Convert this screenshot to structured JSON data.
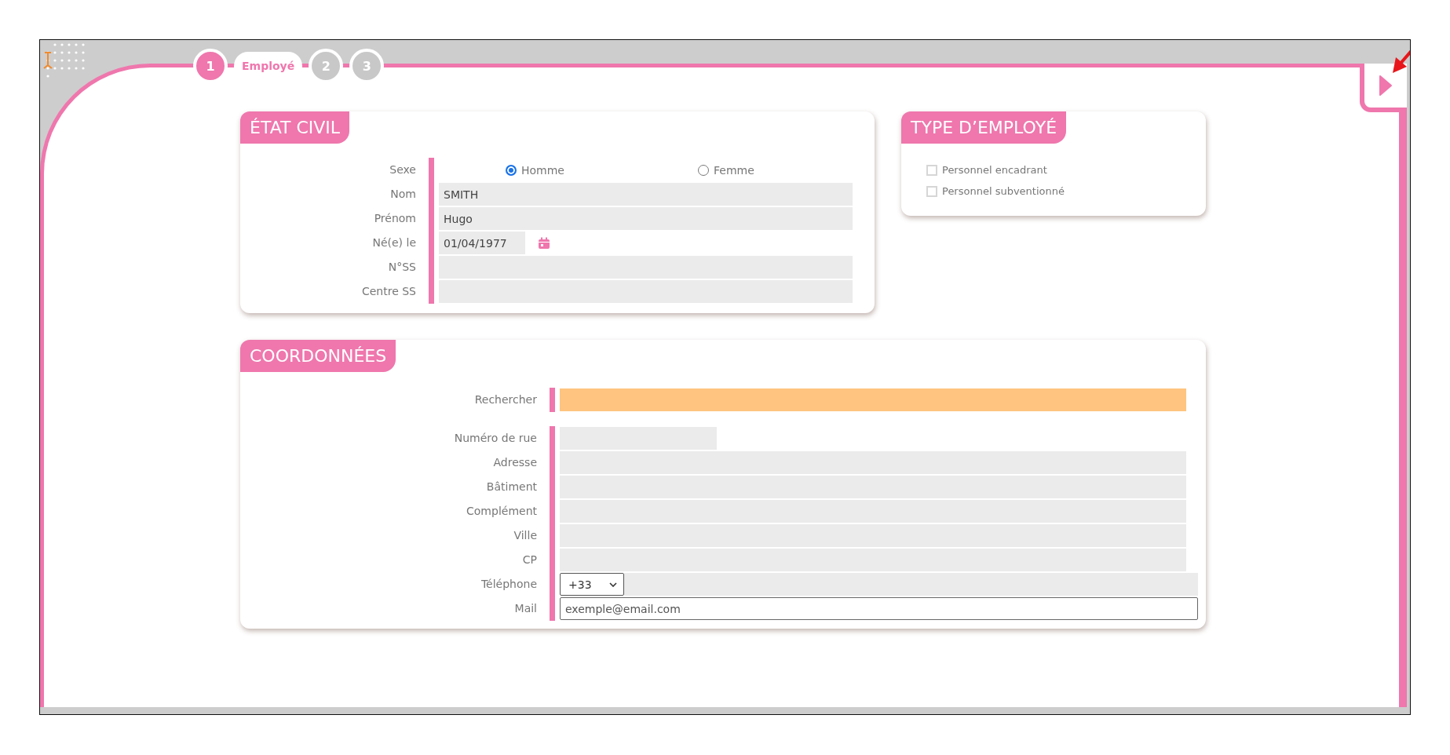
{
  "stepper": {
    "steps": [
      {
        "number": "1",
        "label": "Employé",
        "selected": true
      },
      {
        "number": "2",
        "selected": false
      },
      {
        "number": "3",
        "selected": false
      }
    ]
  },
  "etat_civil": {
    "title": "ÉTAT CIVIL",
    "fields": [
      {
        "kind": "radio",
        "label": "Sexe",
        "options": [
          {
            "label": "Homme",
            "selected": true
          },
          {
            "label": "Femme",
            "selected": false
          }
        ]
      },
      {
        "kind": "text",
        "label": "Nom",
        "value": "SMITH"
      },
      {
        "kind": "text",
        "label": "Prénom",
        "value": "Hugo"
      },
      {
        "kind": "date",
        "label": "Né(e) le",
        "value": "01/04/1977"
      },
      {
        "kind": "text",
        "label": "N°SS"
      },
      {
        "kind": "text",
        "label": "Centre SS"
      }
    ]
  },
  "type_employe": {
    "title": "TYPE D’EMPLOYÉ",
    "options": [
      {
        "label": "Personnel encadrant",
        "checked": false
      },
      {
        "label": "Personnel subventionné",
        "checked": false
      }
    ]
  },
  "coordonnees": {
    "title": "COORDONNÉES",
    "search": {
      "label": "Rechercher"
    },
    "fields": [
      {
        "kind": "short",
        "label": "Numéro de rue"
      },
      {
        "kind": "text",
        "label": "Adresse"
      },
      {
        "kind": "text",
        "label": "Bâtiment"
      },
      {
        "kind": "text",
        "label": "Complément"
      },
      {
        "kind": "text",
        "label": "Ville"
      },
      {
        "kind": "text",
        "label": "CP"
      },
      {
        "kind": "phone",
        "label": "Téléphone",
        "prefix": "+33"
      },
      {
        "kind": "email",
        "label": "Mail",
        "placeholder": "exemple@email.com"
      }
    ]
  }
}
